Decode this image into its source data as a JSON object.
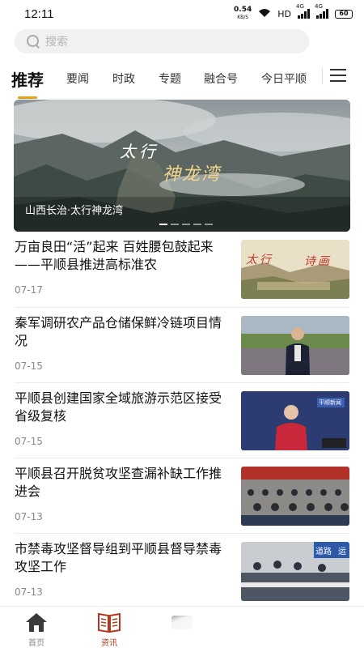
{
  "status_bar": {
    "time": "12:11",
    "net_speed_value": "0.54",
    "net_speed_unit": "KB/S",
    "hd_label": "HD",
    "signal1_label": "4G",
    "signal2_label": "4G",
    "battery": "60"
  },
  "search": {
    "placeholder": "搜索"
  },
  "tabs": [
    {
      "label": "推荐",
      "active": true
    },
    {
      "label": "要闻"
    },
    {
      "label": "时政"
    },
    {
      "label": "专题"
    },
    {
      "label": "融合号"
    },
    {
      "label": "今日平顺"
    }
  ],
  "banner": {
    "image_title_1": "太行",
    "image_title_2": "神龙湾",
    "caption": "山西长治·太行神龙湾"
  },
  "news": [
    {
      "title": "万亩良田“活”起来 百姓腰包鼓起来 ——平顺县推进高标准农",
      "date": "07-17",
      "thumb_text_1": "太行",
      "thumb_text_2": "诗画"
    },
    {
      "title": "秦军调研农产品仓储保鲜冷链项目情况",
      "date": "07-15"
    },
    {
      "title": "平顺县创建国家全域旅游示范区接受省级复核",
      "date": "07-15",
      "thumb_text_1": "平顺新闻"
    },
    {
      "title": "平顺县召开脱贫攻坚查漏补缺工作推进会",
      "date": "07-13"
    },
    {
      "title": "市禁毒攻坚督导组到平顺县督导禁毒攻坚工作",
      "date": "07-13",
      "thumb_text_1": "道路",
      "thumb_text_2": "运"
    }
  ],
  "bottom_nav": [
    {
      "label": "首页",
      "icon": "home-icon"
    },
    {
      "label": "资讯",
      "icon": "book-icon",
      "active": true
    },
    {
      "label": "",
      "icon": "tv-icon"
    }
  ],
  "colors": {
    "accent": "#e0a318",
    "active_nav": "#b5381e"
  }
}
